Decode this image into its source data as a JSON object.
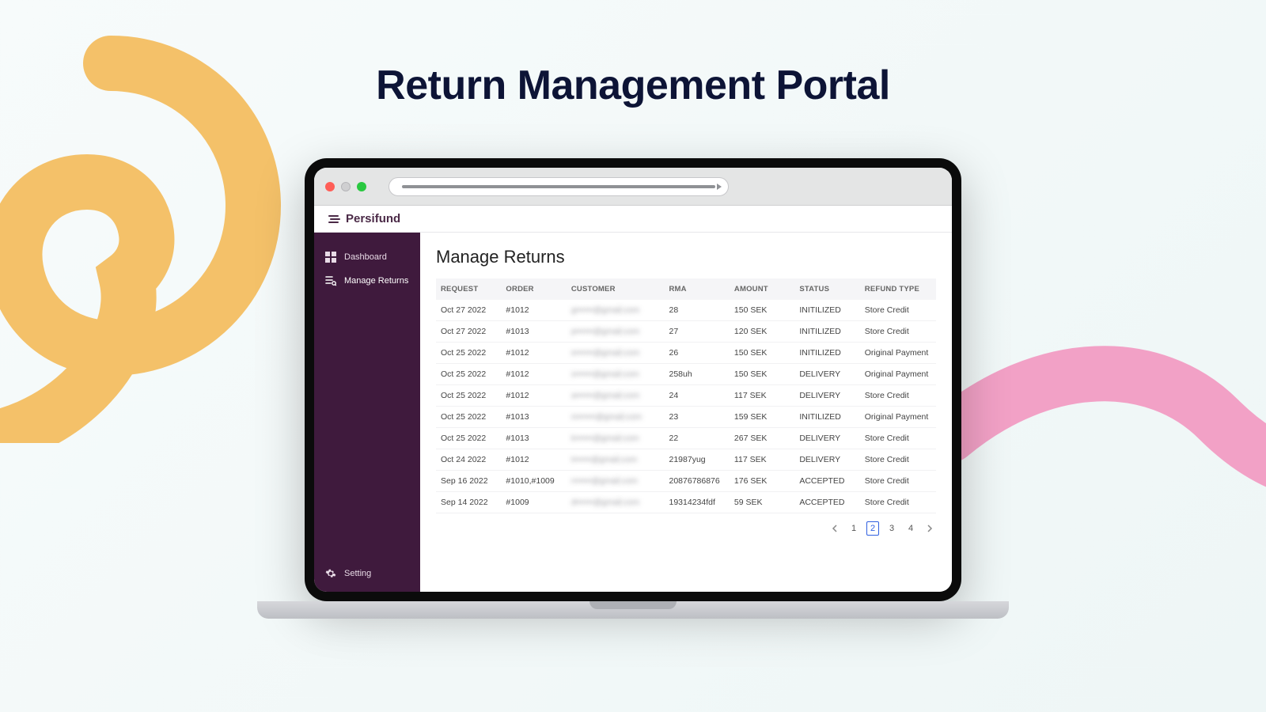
{
  "hero": {
    "title": "Return Management Portal"
  },
  "brand": {
    "name": "Persifund"
  },
  "sidebar": {
    "items": [
      {
        "label": "Dashboard"
      },
      {
        "label": "Manage Returns"
      }
    ],
    "setting_label": "Setting"
  },
  "main": {
    "title": "Manage Returns",
    "columns": {
      "request": "REQUEST",
      "order": "ORDER",
      "customer": "CUSTOMER",
      "rma": "RMA",
      "amount": "AMOUNT",
      "status": "STATUS",
      "refund_type": "REFUND TYPE"
    },
    "rows": [
      {
        "request": "Oct 27 2022",
        "order": "#1012",
        "customer": "g••••••@gmail.com",
        "rma": "28",
        "amount": "150 SEK",
        "status": "INITILIZED",
        "refund_type": "Store Credit"
      },
      {
        "request": "Oct 27 2022",
        "order": "#1013",
        "customer": "p••••••@gmail.com",
        "rma": "27",
        "amount": "120 SEK",
        "status": "INITILIZED",
        "refund_type": "Store Credit"
      },
      {
        "request": "Oct 25 2022",
        "order": "#1012",
        "customer": "e••••••@gmail.com",
        "rma": "26",
        "amount": "150 SEK",
        "status": "INITILIZED",
        "refund_type": "Original Payment"
      },
      {
        "request": "Oct 25 2022",
        "order": "#1012",
        "customer": "s••••••@gmail.com",
        "rma": "258uh",
        "amount": "150 SEK",
        "status": "DELIVERY",
        "refund_type": "Original Payment"
      },
      {
        "request": "Oct 25 2022",
        "order": "#1012",
        "customer": "a••••••@gmail.com",
        "rma": "24",
        "amount": "117 SEK",
        "status": "DELIVERY",
        "refund_type": "Store Credit"
      },
      {
        "request": "Oct 25 2022",
        "order": "#1013",
        "customer": "m••••••@gmail.com",
        "rma": "23",
        "amount": "159 SEK",
        "status": "INITILIZED",
        "refund_type": "Original Payment"
      },
      {
        "request": "Oct 25 2022",
        "order": "#1013",
        "customer": "k••••••@gmail.com",
        "rma": "22",
        "amount": "267 SEK",
        "status": "DELIVERY",
        "refund_type": "Store Credit"
      },
      {
        "request": "Oct 24 2022",
        "order": "#1012",
        "customer": "t••••••@gmail.com",
        "rma": "21987yug",
        "amount": "117 SEK",
        "status": "DELIVERY",
        "refund_type": "Store Credit"
      },
      {
        "request": "Sep 16 2022",
        "order": "#1010,#1009",
        "customer": "r••••••@gmail.com",
        "rma": "20876786876",
        "amount": "176 SEK",
        "status": "ACCEPTED",
        "refund_type": "Store Credit"
      },
      {
        "request": "Sep 14 2022",
        "order": "#1009",
        "customer": "d••••••@gmail.com",
        "rma": "19314234fdf",
        "amount": "59 SEK",
        "status": "ACCEPTED",
        "refund_type": "Store Credit"
      }
    ],
    "pagination": {
      "pages": [
        "1",
        "2",
        "3",
        "4"
      ],
      "active_index": 1
    }
  }
}
